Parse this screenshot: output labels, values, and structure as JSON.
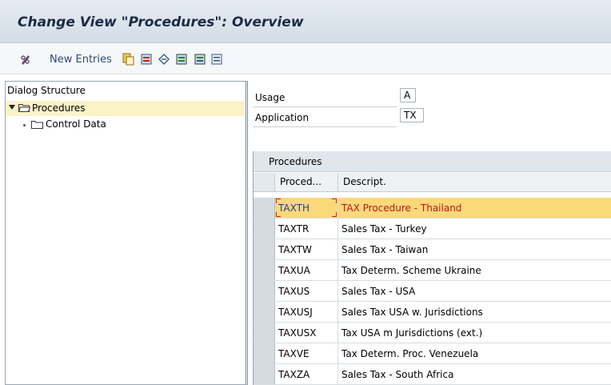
{
  "window": {
    "title": "Change View \"Procedures\": Overview"
  },
  "toolbar": {
    "new_entries_label": "New Entries",
    "icons": [
      "pencil-glasses-icon",
      "copy-icon",
      "delete-icon",
      "undo-icon",
      "select-all-icon",
      "select-block-icon",
      "deselect-all-icon"
    ]
  },
  "dialog_structure": {
    "header": "Dialog Structure",
    "items": [
      {
        "label": "Procedures",
        "selected": true,
        "icon": "open-folder-icon"
      },
      {
        "label": "Control Data",
        "selected": false,
        "icon": "folder-icon"
      }
    ]
  },
  "fields": [
    {
      "label": "Usage",
      "value": "A"
    },
    {
      "label": "Application",
      "value": "TX"
    }
  ],
  "table": {
    "title": "Procedures",
    "columns": [
      "Proced...",
      "Descript."
    ],
    "rows": [
      {
        "code": "TAXTH",
        "desc": "TAX Procedure - Thailand",
        "selected": true
      },
      {
        "code": "TAXTR",
        "desc": "Sales Tax - Turkey"
      },
      {
        "code": "TAXTW",
        "desc": "Sales Tax - Taiwan"
      },
      {
        "code": "TAXUA",
        "desc": "Tax Determ. Scheme Ukraine"
      },
      {
        "code": "TAXUS",
        "desc": "Sales Tax - USA"
      },
      {
        "code": "TAXUSJ",
        "desc": "Sales Tax USA w. Jurisdictions"
      },
      {
        "code": "TAXUSX",
        "desc": "Tax USA m Jurisdictions (ext.)"
      },
      {
        "code": "TAXVE",
        "desc": "Tax Determ. Proc. Venezuela"
      },
      {
        "code": "TAXZA",
        "desc": "Sales Tax - South Africa"
      }
    ]
  },
  "colors": {
    "selected_row": "#fbd97a",
    "selected_tree": "#fbf3c6",
    "selected_desc": "#c0141a",
    "title_text": "#1a2b45"
  }
}
